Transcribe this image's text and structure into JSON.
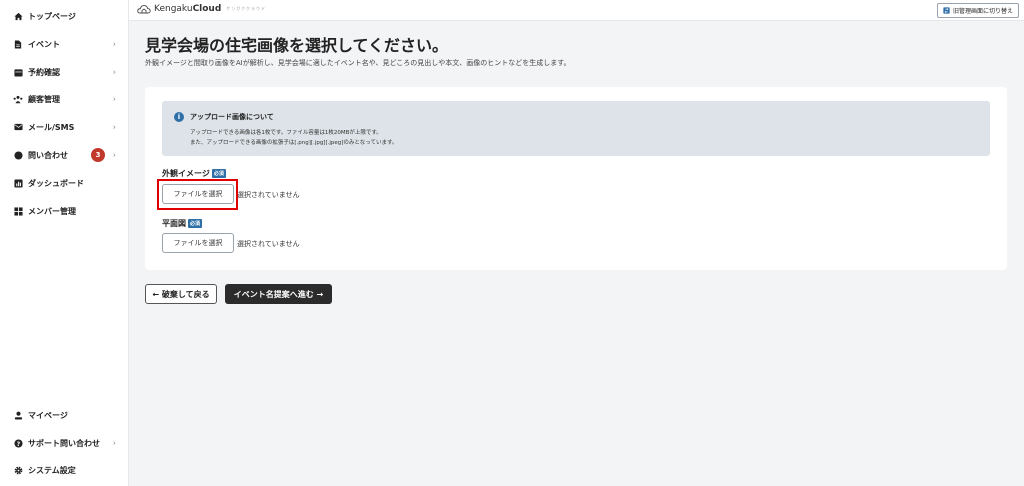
{
  "sidebar": {
    "items": [
      {
        "label": "トップページ",
        "icon": "home-icon",
        "chevron": ""
      },
      {
        "label": "イベント",
        "icon": "document-icon",
        "chevron": "›"
      },
      {
        "label": "予約確認",
        "icon": "calendar-icon",
        "chevron": "›"
      },
      {
        "label": "顧客管理",
        "icon": "people-icon",
        "chevron": "›"
      },
      {
        "label": "メール/SMS",
        "icon": "mail-icon",
        "chevron": "›"
      },
      {
        "label": "問い合わせ",
        "icon": "chat-icon",
        "chevron": "›",
        "badge": "3"
      },
      {
        "label": "ダッシュボード",
        "icon": "chart-icon",
        "chevron": ""
      },
      {
        "label": "メンバー管理",
        "icon": "grid-icon",
        "chevron": ""
      }
    ],
    "bottom_items": [
      {
        "label": "マイページ",
        "icon": "user-icon",
        "chevron": ""
      },
      {
        "label": "サポート問い合わせ",
        "icon": "help-icon",
        "chevron": "›"
      },
      {
        "label": "システム設定",
        "icon": "gear-icon",
        "chevron": ""
      }
    ]
  },
  "topbar": {
    "brand_light": "Kengaku",
    "brand_bold": "Cloud",
    "brand_sub": "ケンガククラウド",
    "switch_label": "旧管理画面に切り替え"
  },
  "main": {
    "title": "見学会場の住宅画像を選択してください。",
    "description": "外観イメージと間取り画像をAIが解析し、見学会場に適したイベント名や、見どころの見出しや本文、画像のヒントなどを生成します。",
    "info": {
      "title": "アップロード画像について",
      "line1": "アップロードできる画像は各1枚です。ファイル容量は1枚20MBが上限です。",
      "line2": "また、アップロードできる画像の拡張子は[.png][.jpg][.jpeg]のみとなっています。"
    },
    "fields": [
      {
        "label": "外観イメージ",
        "required": "必須",
        "button": "ファイルを選択",
        "status": "選択されていません"
      },
      {
        "label": "平面図",
        "required": "必須",
        "button": "ファイルを選択",
        "status": "選択されていません"
      }
    ],
    "back_button": "← 破棄して戻る",
    "next_button": "イベント名提案へ進む →"
  },
  "colors": {
    "accent": "#2f6fa7",
    "badge": "#c0392b",
    "highlight": "#e00000",
    "primary_button": "#2b2b2b"
  }
}
